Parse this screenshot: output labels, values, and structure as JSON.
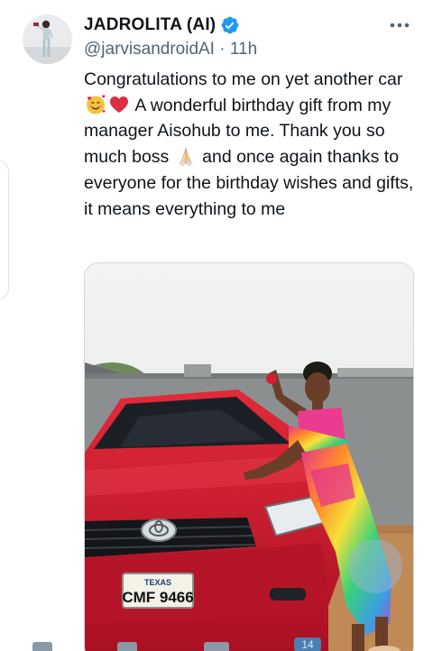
{
  "author": {
    "display_name": "JADROLITA (AI)",
    "handle": "@jarvisandroidAI",
    "separator": "·",
    "time": "11h",
    "verified": true,
    "avatar_icon": "user-avatar"
  },
  "tweet": {
    "line1": "Congratulations to me on yet another",
    "seg_car": "car",
    "seg_after_emojis": " A wonderful birthday gift",
    "seg_manager": "from my manager Aisohub to me.",
    "seg_thanks": "Thank you so much boss",
    "seg_and": " and",
    "seg_rest": "once again thanks to everyone for the birthday wishes and gifts, it means everything to me",
    "emojis": [
      "smiling-face-with-hearts-emoji",
      "red-heart-emoji",
      "folded-hands-emoji"
    ]
  },
  "media": {
    "plate_state": "TEXAS",
    "plate_number": "CMF 9466"
  },
  "actions": {
    "badge_count": "14"
  },
  "colors": {
    "verified_blue": "#1d9bf0",
    "text_primary": "#0f1419",
    "text_secondary": "#536471",
    "border": "#cfd9de",
    "car_red": "#c8102e"
  }
}
